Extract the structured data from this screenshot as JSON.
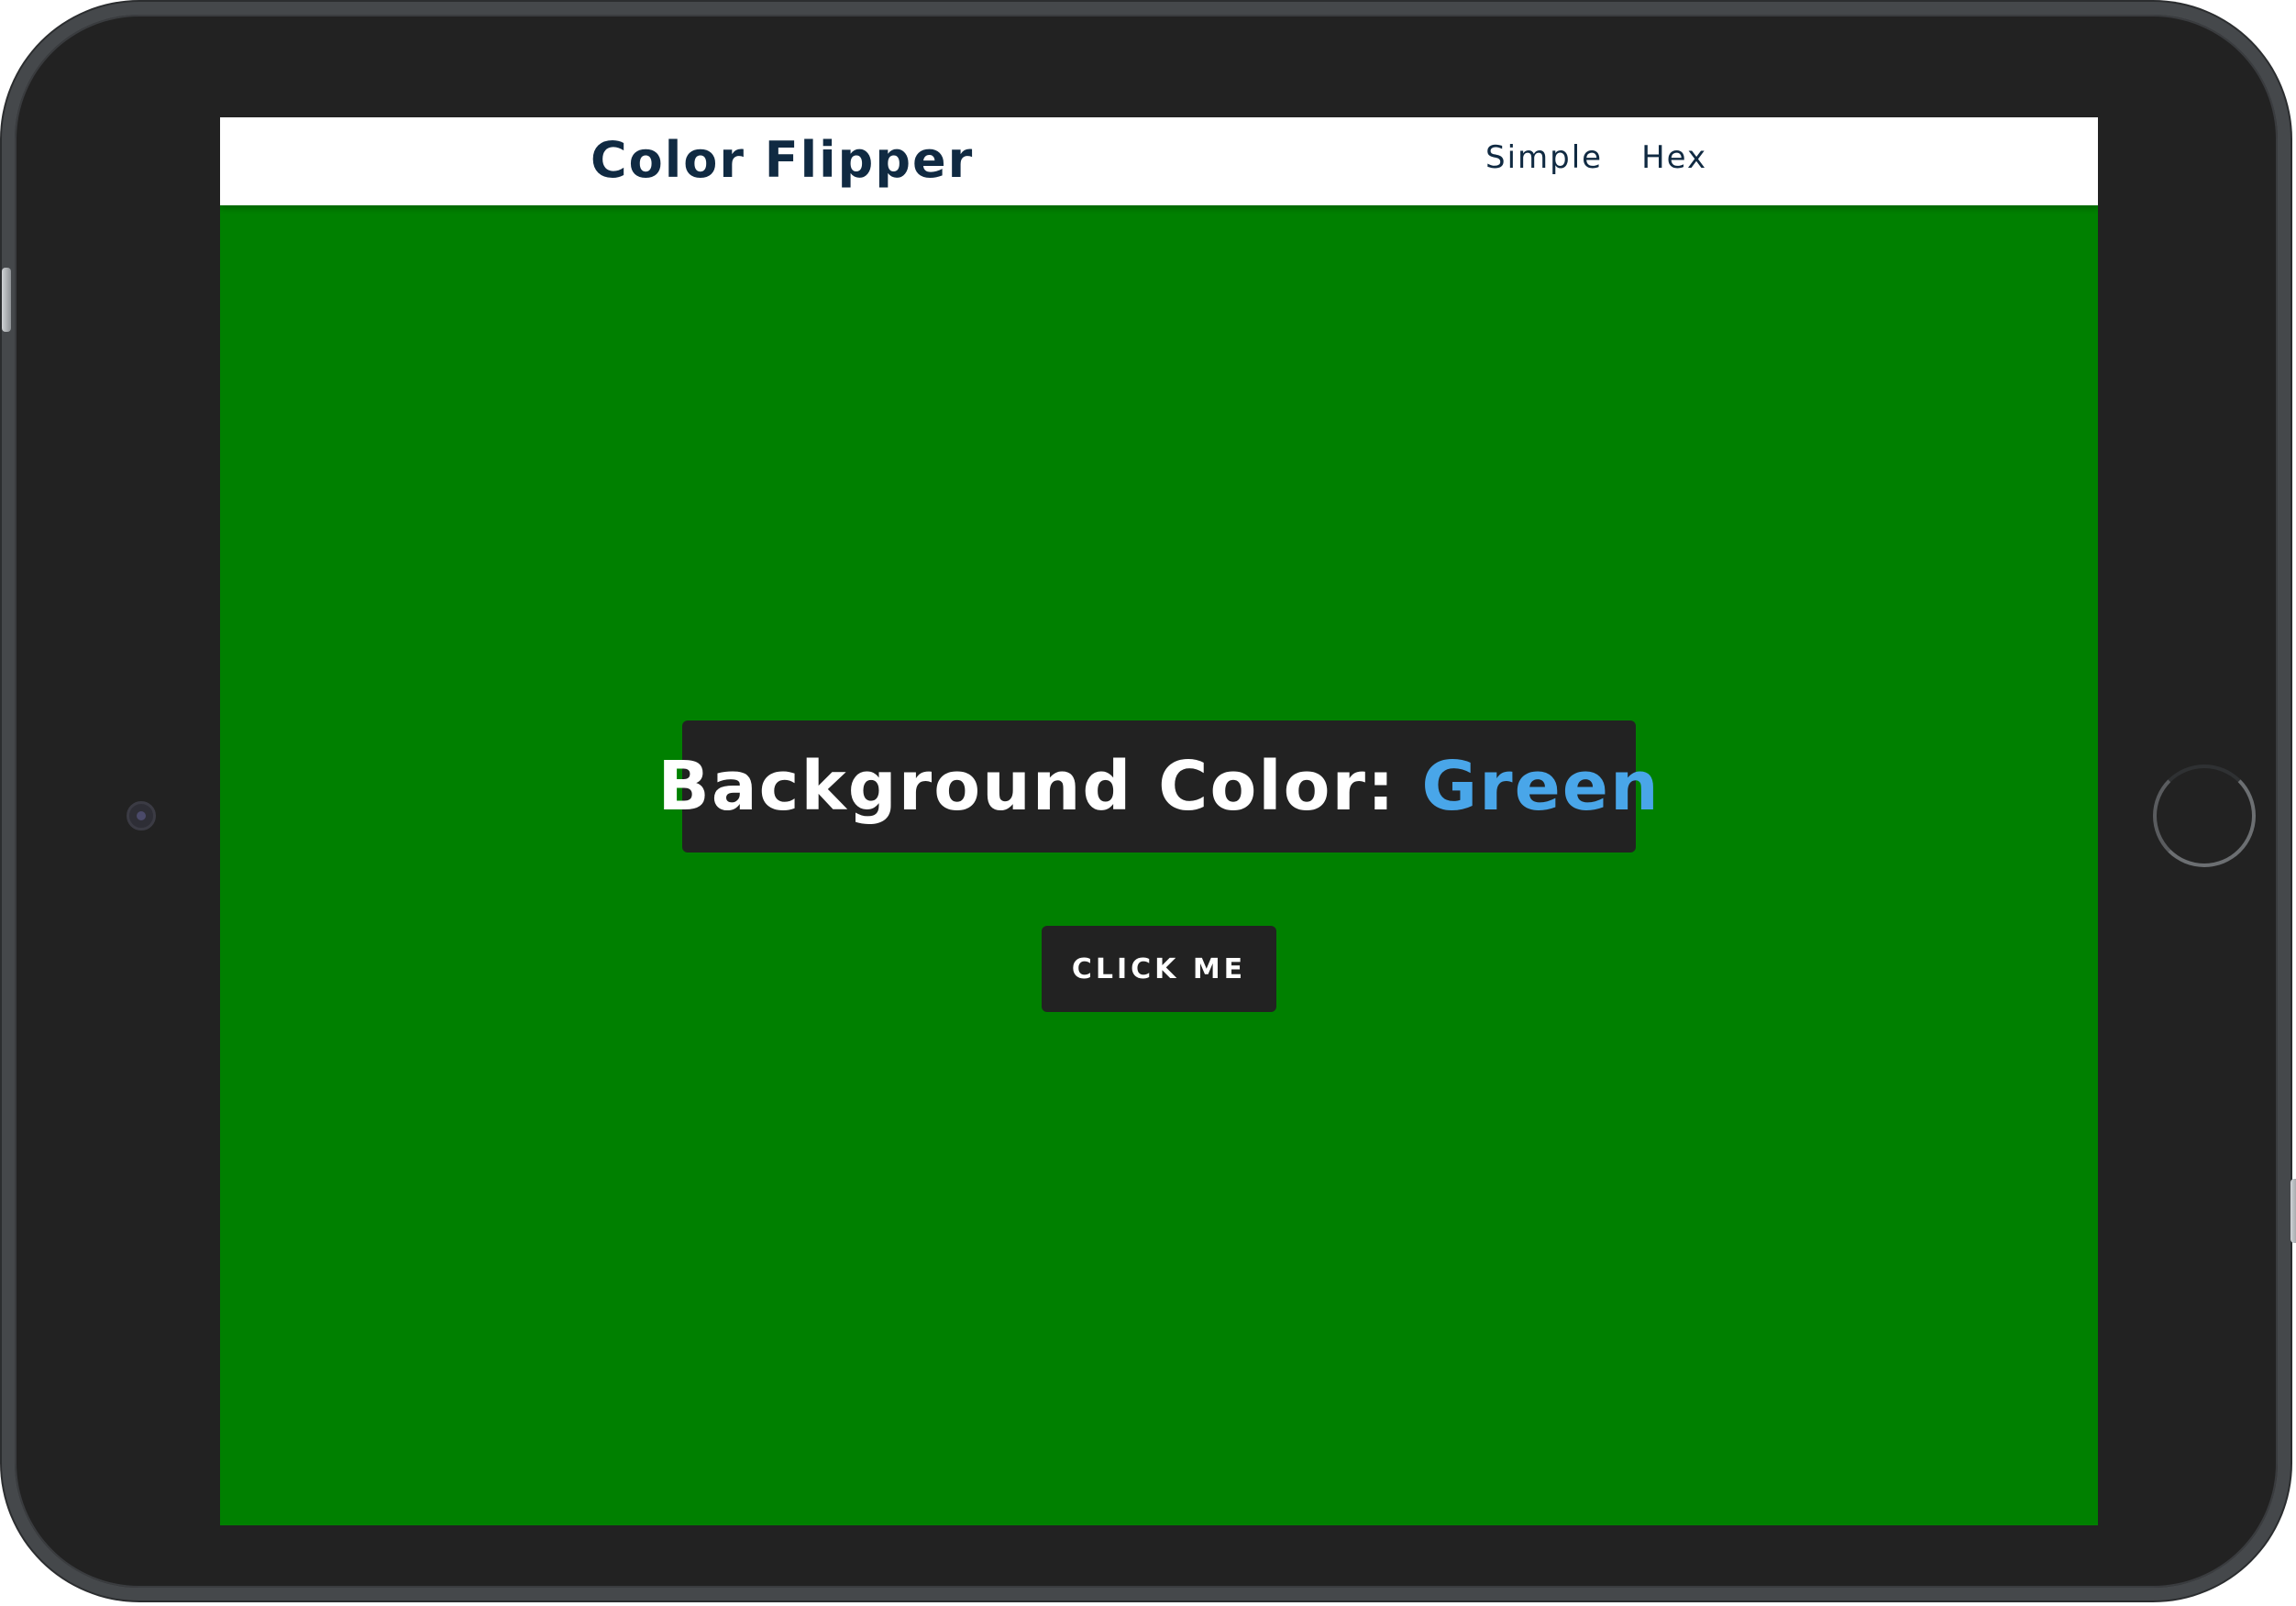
{
  "page": {
    "background_color": "#008000"
  },
  "navbar": {
    "brand": "Color Flipper",
    "links": [
      {
        "label": "Simple"
      },
      {
        "label": "Hex"
      }
    ],
    "text_color": "#102a42"
  },
  "main": {
    "heading_prefix": "Background Color: ",
    "color_name": "Green",
    "color_name_color": "#49a6e9",
    "button_label": "CLICK ME"
  }
}
